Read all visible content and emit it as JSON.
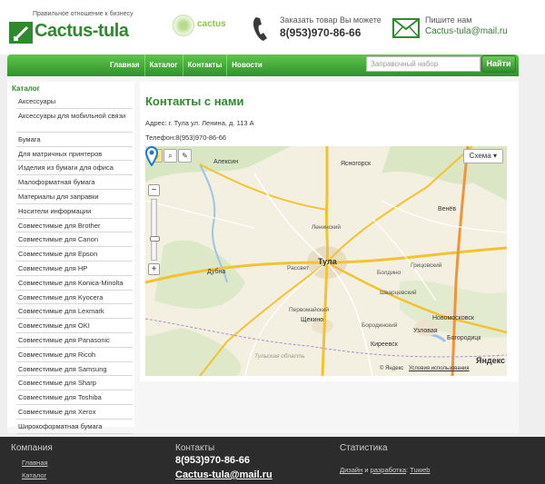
{
  "header": {
    "tagline": "Правильное отношение к бизнесу",
    "brand": "Cactus-tula",
    "partner_badge": "cactus",
    "order_label": "Заказать товар Вы можете",
    "phone": "8(953)970-86-66",
    "mail_label": "Пишите нам",
    "email": "Cactus-tula@mail.ru",
    "accent_color": "#2f8a2f"
  },
  "nav": {
    "links": [
      "Главная",
      "Каталог",
      "Контакты",
      "Новости"
    ],
    "search_placeholder": "Заправочный набор",
    "search_button": "Найти"
  },
  "sidebar": {
    "title": "Каталог",
    "items": [
      "Аксессуары",
      "Аксессуары для мобильной связи",
      "Бумага",
      "Для матричных принтеров",
      "Изделия из бумаги для офиса",
      "Малоформатная бумага",
      "Материалы для заправки",
      "Носители информации",
      "Совместимые для Brother",
      "Совместимые для Canon",
      "Совместимые для Epson",
      "Совместимые для HP",
      "Совместимые для Konica-Minolta",
      "Совместимые для Kyocera",
      "Совместимые для Lexmark",
      "Совместимые для OKI",
      "Совместимые для Panasonic",
      "Совместимые для Ricoh",
      "Совместимые для Samsung",
      "Совместимые для Sharp",
      "Совместимые для Toshiba",
      "Совместимые для Xerox",
      "Широкоформатная бумага"
    ]
  },
  "main": {
    "title": "Контакты с нами",
    "address": "Адрес: г. Тула ул. Ленина, д. 113 А",
    "phone_line": "Телефон:8(953)970-86-66"
  },
  "map": {
    "scheme_button": "Схема ▾",
    "zoom_in": "+",
    "zoom_out": "−",
    "labels": {
      "aleksin": "Алексин",
      "yasnogorsk": "Ясногорск",
      "venev": "Венёв",
      "tula": "Тула",
      "dubna": "Дубна",
      "shchekino": "Щекино",
      "kireevsk": "Киреевск",
      "uzlovaya": "Узловая",
      "novomoskovsk": "Новомосковск",
      "bogoroditsk": "Богородицк",
      "region": "Тульская область",
      "rasset": "Рассвет",
      "pervomaysky": "Первомайский",
      "leninsky": "Ленинский",
      "shvartsevsky": "Шварцевский",
      "boldino": "Болдино",
      "grytsovsky": "Грицовский",
      "borodinsky": "Бородинский"
    },
    "copyright": "© Яндекс",
    "terms": "Условия использования",
    "logo": "Яндекс"
  },
  "footer": {
    "company_title": "Компания",
    "company_links": [
      "Главная",
      "Каталог"
    ],
    "contacts_title": "Контакты",
    "contacts_phone": "8(953)970-86-66",
    "contacts_email": "Cactus-tula@mail.ru",
    "stats_title": "Статистика",
    "credit_design": "Дизайн",
    "credit_and": "и",
    "credit_dev": "разработка",
    "credit_sep": ":",
    "credit_by": "Tuweb"
  }
}
